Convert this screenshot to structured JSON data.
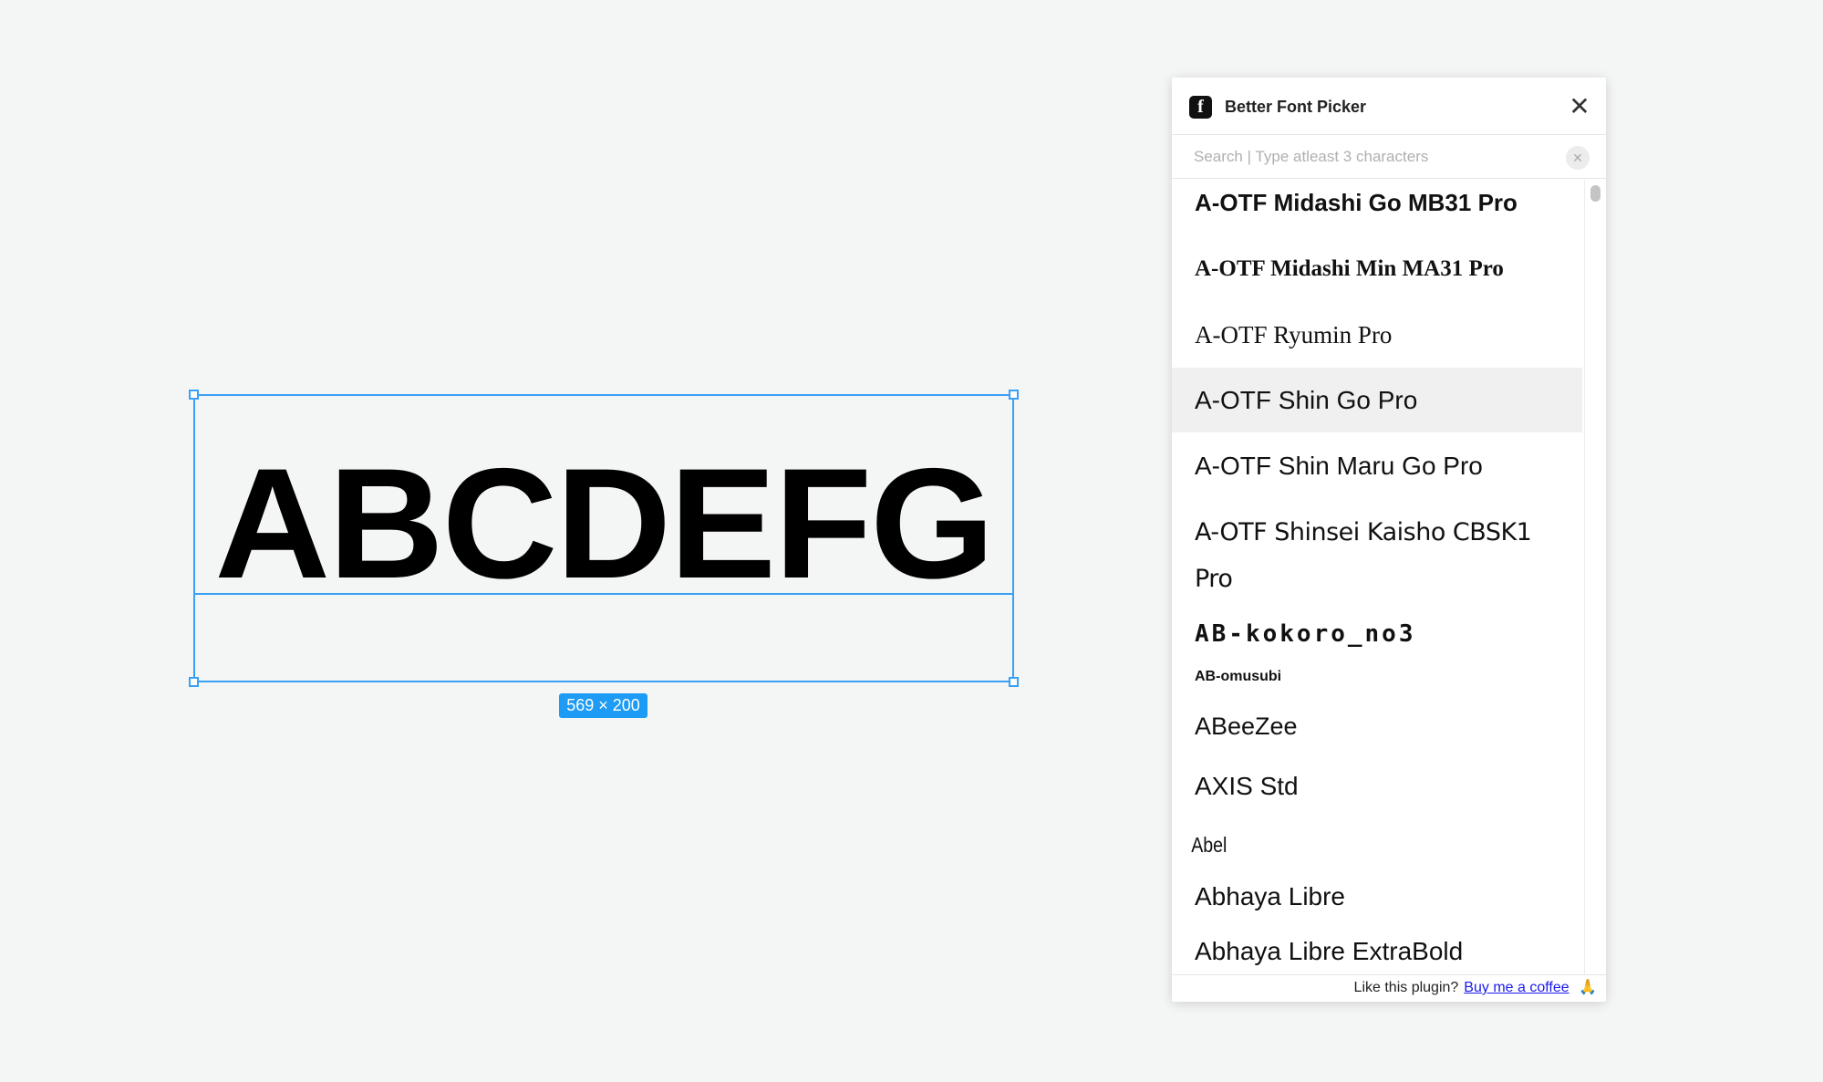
{
  "canvas": {
    "sample_text": "ABCDEFG",
    "dimensions": "569 × 200",
    "selection_color": "#3aa0f5"
  },
  "plugin": {
    "logo": "f",
    "title": "Better Font Picker",
    "search_placeholder": "Search | Type atleast 3 characters",
    "fonts": [
      {
        "label": "A-OTF Midashi Go MB31 Pro"
      },
      {
        "label": "A-OTF Midashi Min MA31 Pro"
      },
      {
        "label": "A-OTF Ryumin Pro"
      },
      {
        "label": "A-OTF Shin Go Pro",
        "selected": true
      },
      {
        "label": "A-OTF Shin Maru Go Pro"
      },
      {
        "label": "A-OTF Shinsei Kaisho CBSK1 Pro"
      },
      {
        "label": "AB-kokoro_no3"
      },
      {
        "label": "AB-omusubi"
      },
      {
        "label": "ABeeZee"
      },
      {
        "label": "AXIS Std"
      },
      {
        "label": "Abel"
      },
      {
        "label": "Abhaya Libre"
      },
      {
        "label": "Abhaya Libre ExtraBold"
      }
    ],
    "footer": {
      "text": "Like this plugin?",
      "link": "Buy me a coffee",
      "emoji": "🙏"
    }
  }
}
